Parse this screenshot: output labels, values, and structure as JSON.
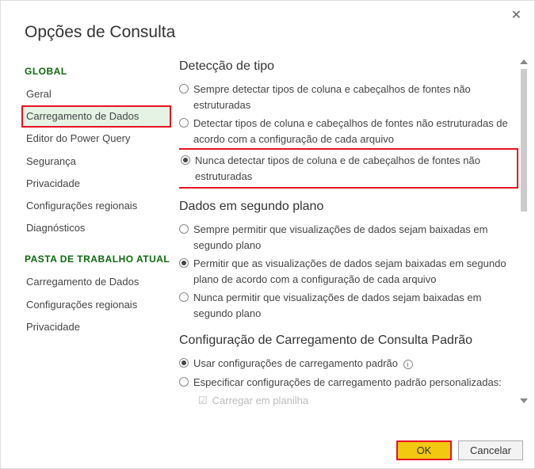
{
  "window": {
    "title": "Opções de Consulta"
  },
  "sidebar": {
    "global_header": "GLOBAL",
    "global_items": [
      "Geral",
      "Carregamento de Dados",
      "Editor do Power Query",
      "Segurança",
      "Privacidade",
      "Configurações regionais",
      "Diagnósticos"
    ],
    "global_selected_index": 1,
    "workbook_header": "PASTA DE TRABALHO ATUAL",
    "workbook_items": [
      "Carregamento de Dados",
      "Configurações regionais",
      "Privacidade"
    ]
  },
  "type_detection": {
    "title": "Detecção de tipo",
    "opt0": "Sempre detectar tipos de coluna e cabeçalhos de fontes não estruturadas",
    "opt1": "Detectar tipos de coluna e cabeçalhos de fontes não estruturadas de acordo com a configuração de cada arquivo",
    "opt2": "Nunca detectar tipos de coluna e de cabeçalhos de fontes não estruturadas",
    "selected": 2
  },
  "background": {
    "title": "Dados em segundo plano",
    "opt0": "Sempre permitir que visualizações de dados sejam baixadas em segundo plano",
    "opt1": "Permitir que as visualizações de dados sejam baixadas em segundo plano de acordo com a configuração de cada arquivo",
    "opt2": "Nunca permitir que visualizações de dados sejam baixadas em segundo plano",
    "selected": 1
  },
  "default_load": {
    "title": "Configuração de Carregamento de Consulta Padrão",
    "opt0": "Usar configurações de carregamento padrão",
    "opt1": "Especificar configurações de carregamento padrão personalizadas:",
    "selected": 0,
    "sub": "Carregar em planilha"
  },
  "buttons": {
    "ok": "OK",
    "cancel": "Cancelar"
  }
}
